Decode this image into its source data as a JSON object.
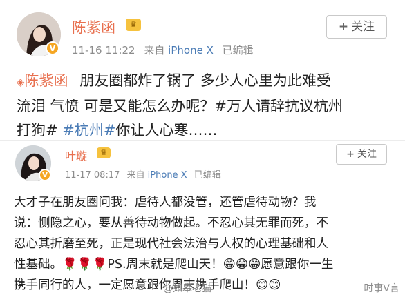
{
  "posts": [
    {
      "username": "陈紫函",
      "timestamp": "11-16 11:22",
      "source_prefix": "来自",
      "device": "iPhone X",
      "edited": "已编辑",
      "follow_label": "关注",
      "body_mention": "陈紫函",
      "body_line1_rest": "朋友圈都炸了锅了 多少人心里为此难受",
      "body_line2": "流泪 气愤 可是又能怎么办呢？#万人请辞抗议杭州",
      "body_line3_prefix": "打狗#",
      "body_tag": "#杭州#",
      "body_line3_suffix": "你让人心寒……"
    },
    {
      "username": "叶璇",
      "timestamp": "11-17 08:17",
      "source_prefix": "来自",
      "device": "iPhone X",
      "edited": "已编辑",
      "follow_label": "关注",
      "body_line1": "大才子在朋友圈问我：虐待人都没管，还管虐待动物？我",
      "body_line2": "说：恻隐之心，要从善待动物做起。不忍心其无罪而死，不",
      "body_line3": "忍心其折磨至死，正是现代社会法治与人权的心理基础和人",
      "body_line4_prefix": "性基础。",
      "body_line4_emoji": "🌹🌹🌹",
      "body_line4_suffix": "PS.周末就是爬山天！😁😁😁愿意跟你一生",
      "body_line5": "携手同行的人，一定愿意跟你周末携手爬山！😊😊"
    }
  ],
  "watermarks": {
    "left": "@如皋老猫",
    "right": "时事V言"
  },
  "colors": {
    "username": "#e8704f",
    "link": "#4a7bb5",
    "meta": "#8c8c8c",
    "badge": "#f5a623"
  }
}
